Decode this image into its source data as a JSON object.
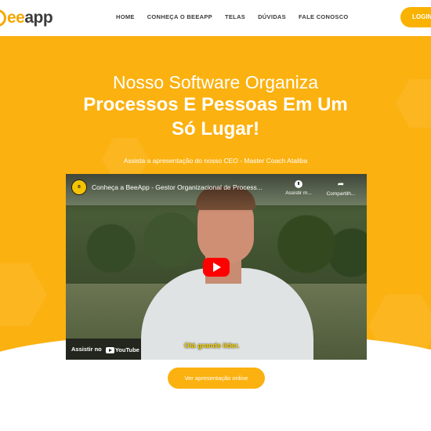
{
  "header": {
    "logo_text_accent": "ee",
    "logo_text_rest": "app",
    "nav": [
      "HOME",
      "CONHEÇA O BEEAPP",
      "TELAS",
      "DÚVIDAS",
      "FALE CONOSCO"
    ],
    "login_label": "LOGIN"
  },
  "hero": {
    "title_line1": "Nosso Software Organiza",
    "title_line2": "Processos E Pessoas Em Um",
    "title_line3": "Só Lugar!",
    "subtitle": "Assista a apresentação do nosso CEO - Master Coach Ataliba",
    "background_color": "#fbb110"
  },
  "video": {
    "title": "Conheça a BeeApp - Gestor Organizacional de Process...",
    "watch_later_label": "Assistir m...",
    "share_label": "Compartilh...",
    "watch_on_label": "Assistir no",
    "youtube_label": "YouTube",
    "caption": "Olá grande líder."
  },
  "cta": {
    "label": "Ver apresentação online"
  },
  "colors": {
    "accent": "#fbb110",
    "youtube_red": "#ff0000"
  }
}
